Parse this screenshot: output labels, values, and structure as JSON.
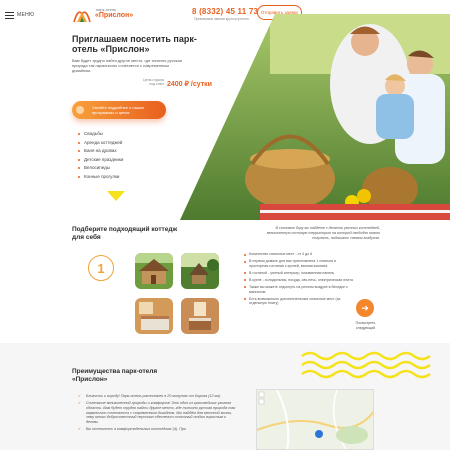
{
  "header": {
    "menu_label": "МЕНЮ",
    "logo_subtitle": "парк-отель",
    "logo_name": "«Прислон»",
    "phone": "8 (8332) 45 11 73",
    "phone_note": "Принимаем звонки круглосуточно",
    "feedback_button": "Отправить заявку"
  },
  "hero": {
    "title": "Приглашаем посетить парк-отель «Прислон»",
    "lead": "Вам будет трудно найти другое место, где типично русская природа так гармонично сочетается с современным дизайном.",
    "price_label": "Цена отдыха под ключ",
    "price": "2400 ₽ /сутки",
    "cta": "Узнайте подробнее о наших программах и ценах",
    "features": [
      "Свадьбы",
      "Аренда коттеджей",
      "Баня на дровах",
      "Детские праздники",
      "Велосипеды",
      "Конные прогулки"
    ]
  },
  "cottage": {
    "title": "Подберите подходящий коттедж для себя",
    "number": "1",
    "description": "В сосновом бору вы найдете с десяток уютных коттеджей, великолепную сосновую территорию на которой свободно можно погулять, подышать свежим воздухом.",
    "specs": [
      "Количество спальных мест - от 4 до 6",
      "В первом домике для вас приготовлена 1 спальня и просторная гостиная с кухней, ванная комната",
      "В гостиной - уютный интерьер, плазменная панель",
      "В кухне - холодильник, посуда, свч-печь, электрическая плита",
      "Также вы можете отдохнуть на речном воздухе в беседке с мангалом",
      "Есть возможность дополнительные спальные мест (за отдельную плату)"
    ],
    "next_label": "Посмотреть следующий"
  },
  "advantages": {
    "title": "Преимущества парк-отеля «Прислон»",
    "items": [
      "Близость к городу! Парк-отель расположен в 20 минутах от Кирова (12 км).",
      "Сочетание великолепной природы и комфорта! Это один из красивейших уголков области. Вам будет трудно найти другое место, где типично русская природа так гармонично сочетается с современным дизайном. Мы найдём для местной жизни, чему много добросовестный персонал обеспечит отличный отдых взрослым и детям.",
      "Вы поселитесь в комфортабельных коттеджах (4). При"
    ]
  },
  "colors": {
    "accent": "#e85f1e",
    "accent_light": "#f7a13b",
    "wave": "#f5e21b"
  }
}
